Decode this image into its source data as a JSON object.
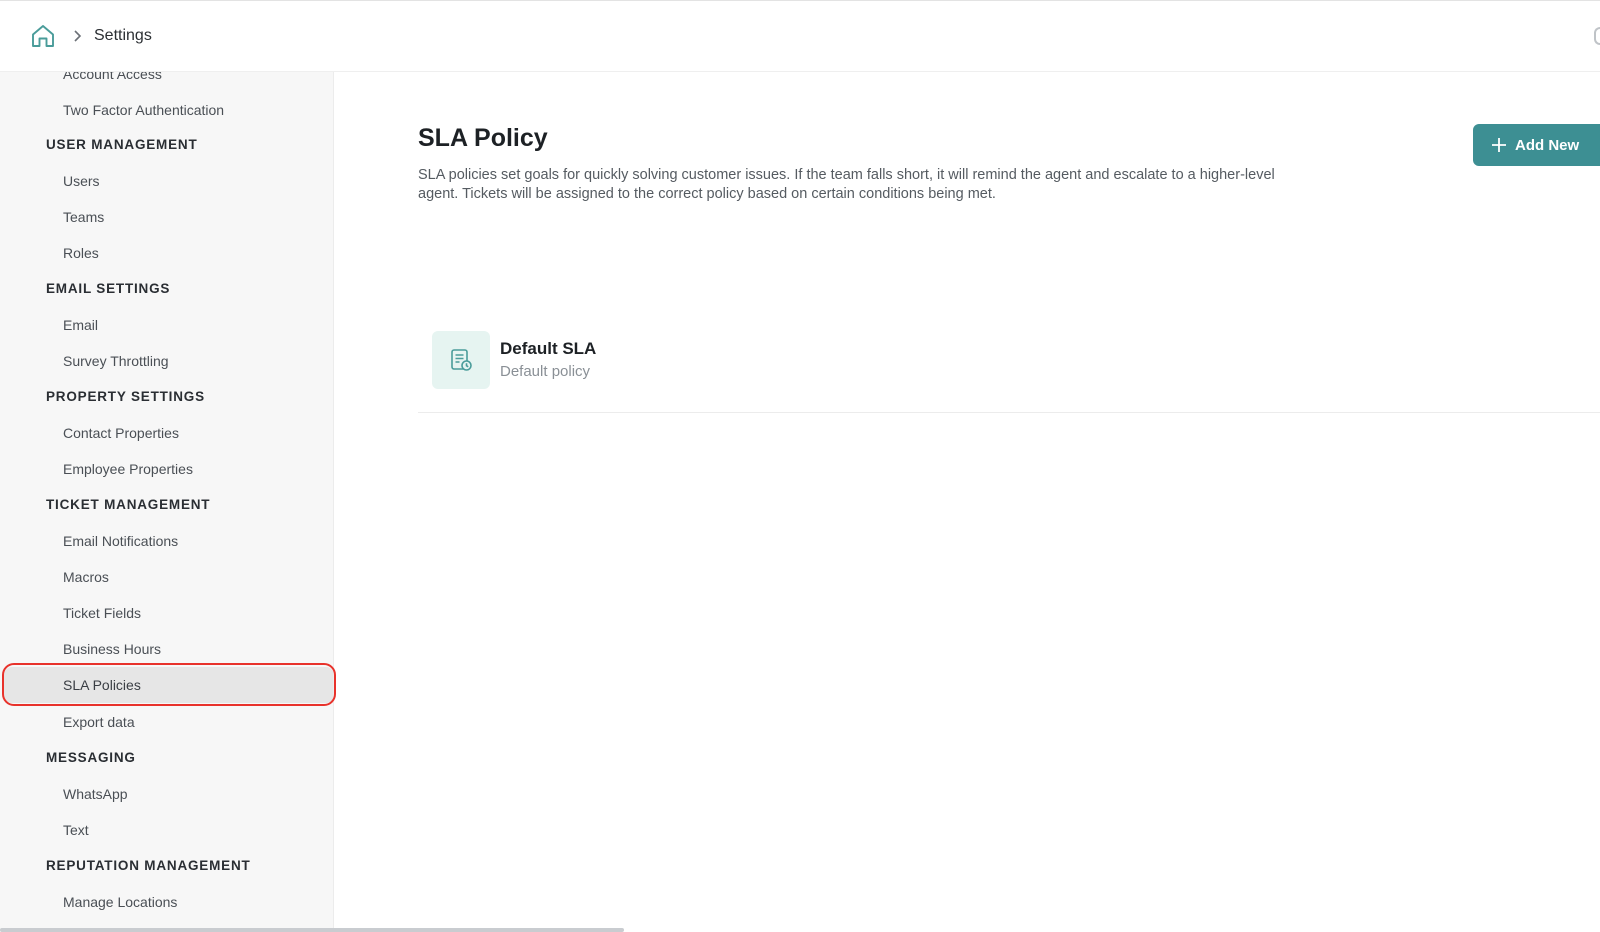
{
  "breadcrumb": {
    "home_icon": "home-icon",
    "separator_icon": "chevron-right-icon",
    "current": "Settings"
  },
  "sidebar": {
    "sections": [
      {
        "title": "",
        "items": [
          "Account Access",
          "Two Factor Authentication"
        ]
      },
      {
        "title": "USER MANAGEMENT",
        "items": [
          "Users",
          "Teams",
          "Roles"
        ]
      },
      {
        "title": "EMAIL SETTINGS",
        "items": [
          "Email",
          "Survey Throttling"
        ]
      },
      {
        "title": "PROPERTY SETTINGS",
        "items": [
          "Contact Properties",
          "Employee Properties"
        ]
      },
      {
        "title": "TICKET MANAGEMENT",
        "items": [
          "Email Notifications",
          "Macros",
          "Ticket Fields",
          "Business Hours",
          "SLA Policies",
          "Export data"
        ]
      },
      {
        "title": "MESSAGING",
        "items": [
          "WhatsApp",
          "Text"
        ]
      },
      {
        "title": "REPUTATION MANAGEMENT",
        "items": [
          "Manage Locations"
        ]
      }
    ],
    "active_item": "SLA Policies"
  },
  "main": {
    "title": "SLA Policy",
    "description": "SLA policies set goals for quickly solving customer issues. If the team falls short, it will remind the agent and escalate to a higher-level agent. Tickets will be assigned to the correct policy based on certain conditions being met.",
    "add_button_label": "Add New",
    "policies": [
      {
        "name": "Default SLA",
        "subtitle": "Default policy",
        "icon": "sla-document-clock-icon"
      }
    ]
  },
  "colors": {
    "accent": "#3d8f93",
    "icon_tint": "#4a9c9a",
    "highlight": "#e8322b",
    "sidebar_bg": "#f7f7f7",
    "active_bg": "#e6e6e6"
  }
}
